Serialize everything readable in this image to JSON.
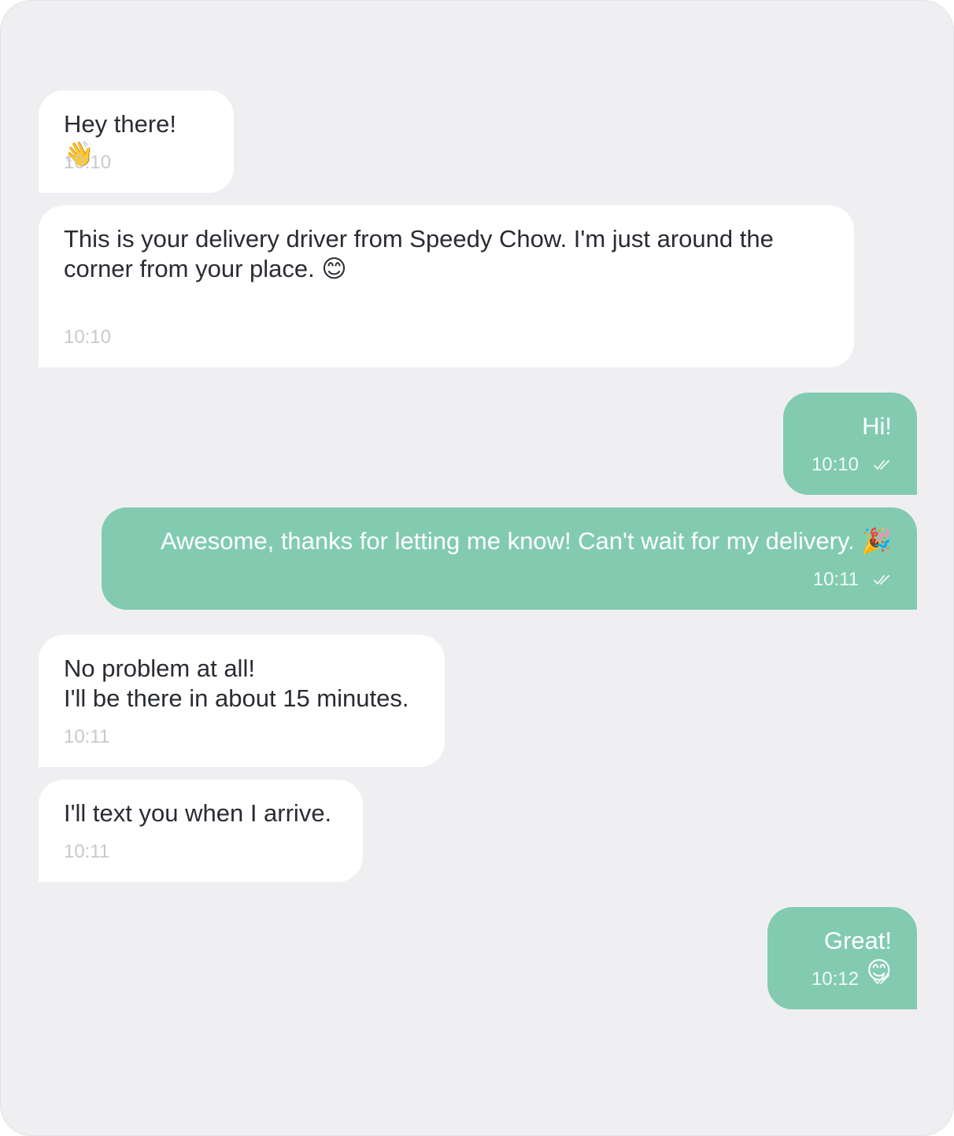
{
  "messages": [
    {
      "direction": "incoming",
      "text": "Hey there! 👋",
      "time": "10:10"
    },
    {
      "direction": "incoming",
      "text": "This is your delivery driver from Speedy Chow. I'm just around the corner from your place. 😊",
      "time": "10:10"
    },
    {
      "direction": "outgoing",
      "text": "Hi!",
      "time": "10:10",
      "status_icon": "double-check-icon"
    },
    {
      "direction": "outgoing",
      "text": "Awesome, thanks for letting me know! Can't wait for my delivery. 🎉",
      "time": "10:11",
      "status_icon": "double-check-icon"
    },
    {
      "direction": "incoming",
      "text": "No problem at all!\nI'll be there in about 15 minutes.",
      "time": "10:11"
    },
    {
      "direction": "incoming",
      "text": "I'll text you when I arrive.",
      "time": "10:11"
    },
    {
      "direction": "outgoing",
      "text": "Great! 😊",
      "time": "10:12",
      "status_icon": "double-check-icon"
    }
  ],
  "colors": {
    "background": "#efeff1",
    "incoming_bubble": "#ffffff",
    "outgoing_bubble": "#82cbb1",
    "incoming_text": "#2a2c33",
    "timestamp_incoming": "#c8c9ce"
  }
}
